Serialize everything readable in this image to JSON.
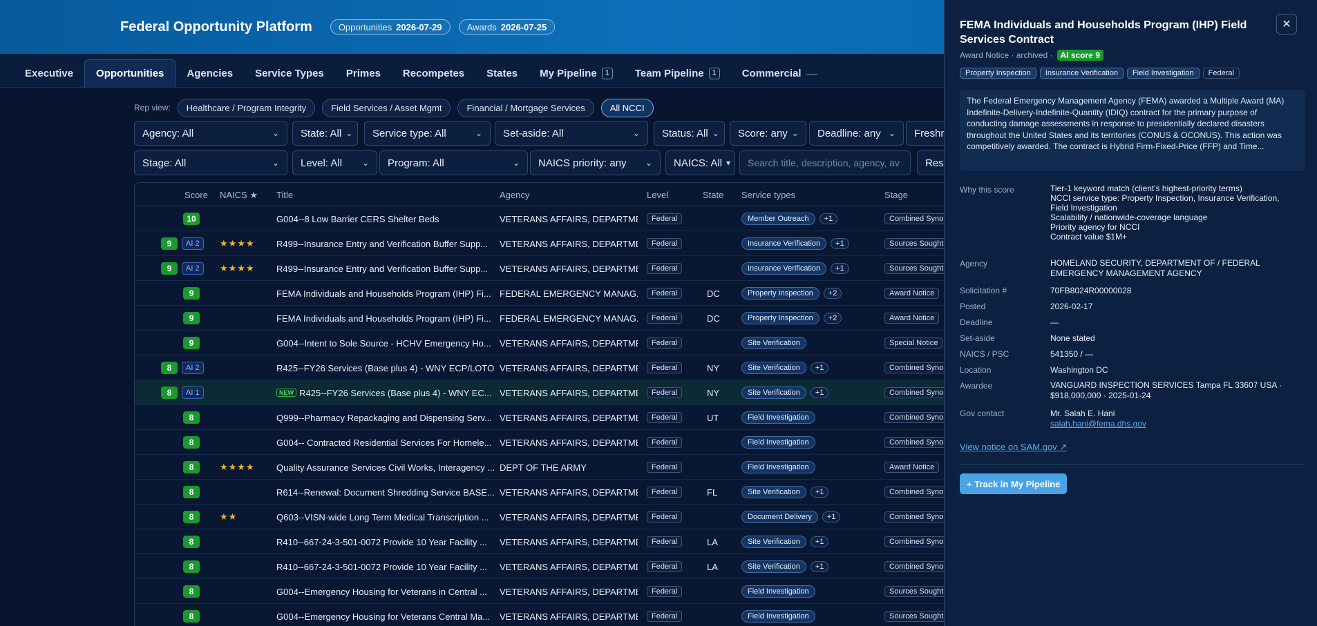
{
  "header": {
    "title": "Federal Opportunity Platform",
    "pills": [
      {
        "label": "Opportunities",
        "date": "2026-07-29"
      },
      {
        "label": "Awards",
        "date": "2026-07-25"
      }
    ]
  },
  "tabs": [
    {
      "label": "Executive"
    },
    {
      "label": "Opportunities"
    },
    {
      "label": "Agencies"
    },
    {
      "label": "Service Types"
    },
    {
      "label": "Primes"
    },
    {
      "label": "Recompetes"
    },
    {
      "label": "States"
    },
    {
      "label": "My Pipeline",
      "count": "1"
    },
    {
      "label": "Team Pipeline",
      "count": "1"
    },
    {
      "label": "Commercial"
    }
  ],
  "rep_view": {
    "label": "Rep view:",
    "options": [
      "Healthcare / Program Integrity",
      "Field Services / Asset Mgmt",
      "Financial / Mortgage Services",
      "All NCCI"
    ]
  },
  "filters": {
    "agency": "Agency: All",
    "state": "State: All",
    "service_type": "Service type: All",
    "set_aside": "Set-aside: All",
    "status": "Status: All",
    "score": "Score: any",
    "deadline": "Deadline: any",
    "freshness": "Freshn",
    "stage": "Stage: All",
    "level": "Level: All",
    "program": "Program: All",
    "naics_priority": "NAICS priority: any",
    "naics": "NAICS: All",
    "search_placeholder": "Search title, description, agency, av",
    "reset": "Rese"
  },
  "table": {
    "columns": [
      "Score",
      "NAICS ★",
      "Title",
      "Agency",
      "Level",
      "State",
      "Service types",
      "Stage"
    ],
    "rows": [
      {
        "score": "10",
        "ai": "",
        "stars": "",
        "new": "",
        "title": "G004--8 Low Barrier CERS Shelter Beds",
        "agency": "VETERANS AFFAIRS, DEPARTME...",
        "level": "Federal",
        "state": "",
        "service": "Member Outreach",
        "plus": "+1",
        "stage": "Combined Synop"
      },
      {
        "score": "9",
        "ai": "AI 2",
        "stars": "★★★★",
        "new": "",
        "title": "R499--Insurance Entry and Verification Buffer Supp...",
        "agency": "VETERANS AFFAIRS, DEPARTME...",
        "level": "Federal",
        "state": "",
        "service": "Insurance Verification",
        "plus": "+1",
        "stage": "Sources Sought"
      },
      {
        "score": "9",
        "ai": "AI 2",
        "stars": "★★★★",
        "new": "",
        "title": "R499--Insurance Entry and Verification Buffer Supp...",
        "agency": "VETERANS AFFAIRS, DEPARTME...",
        "level": "Federal",
        "state": "",
        "service": "Insurance Verification",
        "plus": "+1",
        "stage": "Sources Sought"
      },
      {
        "score": "9",
        "ai": "",
        "stars": "",
        "new": "",
        "title": "FEMA Individuals and Households Program (IHP) Fi...",
        "agency": "FEDERAL EMERGENCY MANAG...",
        "level": "Federal",
        "state": "DC",
        "service": "Property Inspection",
        "plus": "+2",
        "stage": "Award Notice"
      },
      {
        "score": "9",
        "ai": "",
        "stars": "",
        "new": "",
        "title": "FEMA Individuals and Households Program (IHP) Fi...",
        "agency": "FEDERAL EMERGENCY MANAG...",
        "level": "Federal",
        "state": "DC",
        "service": "Property Inspection",
        "plus": "+2",
        "stage": "Award Notice"
      },
      {
        "score": "9",
        "ai": "",
        "stars": "",
        "new": "",
        "title": "G004--Intent to Sole Source - HCHV Emergency Ho...",
        "agency": "VETERANS AFFAIRS, DEPARTME...",
        "level": "Federal",
        "state": "",
        "service": "Site Verification",
        "plus": "",
        "stage": "Special Notice"
      },
      {
        "score": "8",
        "ai": "AI 2",
        "stars": "",
        "new": "",
        "title": "R425--FY26 Services (Base plus 4) - WNY ECP/LOTO...",
        "agency": "VETERANS AFFAIRS, DEPARTME...",
        "level": "Federal",
        "state": "NY",
        "service": "Site Verification",
        "plus": "+1",
        "stage": "Combined Synop"
      },
      {
        "score": "8",
        "ai": "AI 1",
        "stars": "",
        "new": "NEW",
        "title": "R425--FY26 Services (Base plus 4) - WNY EC...",
        "agency": "VETERANS AFFAIRS, DEPARTME...",
        "level": "Federal",
        "state": "NY",
        "service": "Site Verification",
        "plus": "+1",
        "stage": "Combined Synop"
      },
      {
        "score": "8",
        "ai": "",
        "stars": "",
        "new": "",
        "title": "Q999--Pharmacy Repackaging and Dispensing Serv...",
        "agency": "VETERANS AFFAIRS, DEPARTME...",
        "level": "Federal",
        "state": "UT",
        "service": "Field Investigation",
        "plus": "",
        "stage": "Combined Synop"
      },
      {
        "score": "8",
        "ai": "",
        "stars": "",
        "new": "",
        "title": "G004-- Contracted Residential Services For Homele...",
        "agency": "VETERANS AFFAIRS, DEPARTME...",
        "level": "Federal",
        "state": "",
        "service": "Field Investigation",
        "plus": "",
        "stage": "Combined Synop"
      },
      {
        "score": "8",
        "ai": "",
        "stars": "★★★★",
        "new": "",
        "title": "Quality Assurance Services Civil Works, Interagency ...",
        "agency": "DEPT OF THE ARMY",
        "level": "Federal",
        "state": "",
        "service": "Field Investigation",
        "plus": "",
        "stage": "Award Notice"
      },
      {
        "score": "8",
        "ai": "",
        "stars": "",
        "new": "",
        "title": "R614--Renewal: Document Shredding Service BASE...",
        "agency": "VETERANS AFFAIRS, DEPARTME...",
        "level": "Federal",
        "state": "FL",
        "service": "Site Verification",
        "plus": "+1",
        "stage": "Combined Synop"
      },
      {
        "score": "8",
        "ai": "",
        "stars": "★★",
        "new": "",
        "title": "Q603--VISN-wide Long Term Medical Transcription ...",
        "agency": "VETERANS AFFAIRS, DEPARTME...",
        "level": "Federal",
        "state": "",
        "service": "Document Delivery",
        "plus": "+1",
        "stage": "Combined Synop"
      },
      {
        "score": "8",
        "ai": "",
        "stars": "",
        "new": "",
        "title": "R410--667-24-3-501-0072 Provide 10 Year Facility ...",
        "agency": "VETERANS AFFAIRS, DEPARTME...",
        "level": "Federal",
        "state": "LA",
        "service": "Site Verification",
        "plus": "+1",
        "stage": "Combined Synop"
      },
      {
        "score": "8",
        "ai": "",
        "stars": "",
        "new": "",
        "title": "R410--667-24-3-501-0072 Provide 10 Year Facility ...",
        "agency": "VETERANS AFFAIRS, DEPARTME...",
        "level": "Federal",
        "state": "LA",
        "service": "Site Verification",
        "plus": "+1",
        "stage": "Combined Synop"
      },
      {
        "score": "8",
        "ai": "",
        "stars": "",
        "new": "",
        "title": "G004--Emergency Housing for Veterans in Central ...",
        "agency": "VETERANS AFFAIRS, DEPARTME...",
        "level": "Federal",
        "state": "",
        "service": "Field Investigation",
        "plus": "",
        "stage": "Sources Sought"
      },
      {
        "score": "8",
        "ai": "",
        "stars": "",
        "new": "",
        "title": "G004--Emergency Housing for Veterans Central Ma...",
        "agency": "VETERANS AFFAIRS, DEPARTME...",
        "level": "Federal",
        "state": "",
        "service": "Field Investigation",
        "plus": "",
        "stage": "Sources Sought"
      }
    ]
  },
  "panel": {
    "title": "FEMA Individuals and Households Program (IHP) Field Services Contract",
    "close": "✕",
    "subtitle": "Award Notice · archived ·",
    "ai_score": "AI score 9",
    "tags": [
      "Property Inspection",
      "Insurance Verification",
      "Field Investigation",
      "Federal"
    ],
    "description": "The Federal Emergency Management Agency (FEMA) awarded a Multiple Award (MA) Indefinite-Delivery-Indefinite-Quantity (IDIQ) contract for the primary purpose of conducting damage assessments in response to presidentially declared disasters throughout the United States and its territories (CONUS & OCONUS). This action was competitively awarded. The contract is Hybrid Firm-Fixed-Price (FFP) and Time...",
    "why_label": "Why this score",
    "why_lines": [
      "Tier-1 keyword match (client's highest-priority terms)",
      "NCCI service type: Property Inspection, Insurance Verification, Field Investigation",
      "Scalability / nationwide-coverage language",
      "Priority agency for NCCI",
      "Contract value $1M+"
    ],
    "agency_label": "Agency",
    "agency": "HOMELAND SECURITY, DEPARTMENT OF / FEDERAL EMERGENCY MANAGEMENT AGENCY",
    "solicitation_label": "Solicitation #",
    "solicitation": "70FB8024R00000028",
    "posted_label": "Posted",
    "posted": "2026-02-17",
    "deadline_label": "Deadline",
    "deadline": "—",
    "setaside_label": "Set-aside",
    "setaside": "None stated",
    "naics_label": "NAICS / PSC",
    "naics": "541350 / —",
    "location_label": "Location",
    "location": "Washington DC",
    "awardee_label": "Awardee",
    "awardee": "VANGUARD INSPECTION SERVICES Tampa FL 33607 USA · $918,000,000 · 2025-01-24",
    "contact_label": "Gov contact",
    "contact_name": "Mr. Salah E. Hani",
    "contact_email": "salah.hani@fema.dhs.gov",
    "link": "View notice on SAM.gov ↗",
    "track_button": "+ Track in My Pipeline"
  }
}
